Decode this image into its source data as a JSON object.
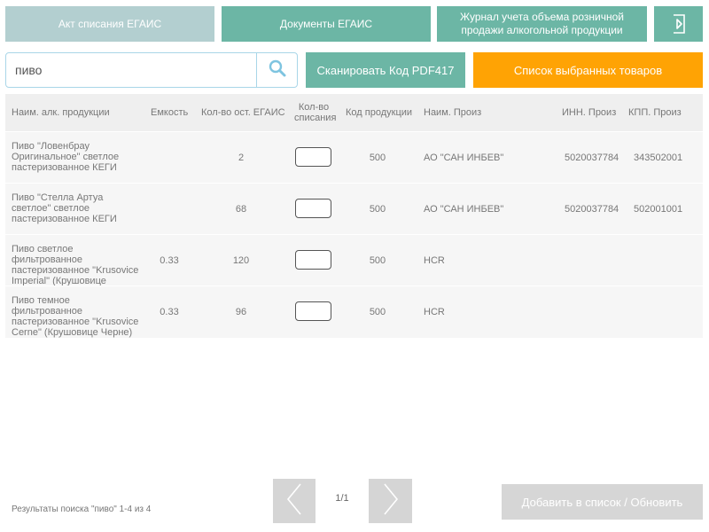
{
  "toolbar": {
    "act_label": "Акт списания ЕГАИС",
    "docs_label": "Документы ЕГАИС",
    "journal_label": "Журнал учета объема розничной продажи алкогольной продукции",
    "exit_icon": "exit-arrow-icon"
  },
  "search": {
    "value": "пиво",
    "icon": "search-icon"
  },
  "actions": {
    "scan_label": "Сканировать Код PDF417",
    "selected_label": "Список выбранных товаров",
    "add_label": "Добавить в список / Обновить"
  },
  "table": {
    "headers": {
      "name": "Наим. алк. продукции",
      "capacity": "Емкость",
      "stock": "Кол-во ост. ЕГАИС",
      "writeoff": "Кол-во списания",
      "code": "Код продукции",
      "producer": "Наим. Произ",
      "inn": "ИНН. Произ",
      "kpp": "КПП. Произ"
    },
    "rows": [
      {
        "name": "Пиво \"Ловенбрау Оригинальное\" светлое пастеризованное КЕГИ",
        "capacity": "",
        "stock": "2",
        "writeoff": "",
        "code": "500",
        "producer": "АО \"САН ИНБЕВ\"",
        "inn": "5020037784",
        "kpp": "343502001"
      },
      {
        "name": "Пиво \"Стелла Артуа светлое\" светлое пастеризованное КЕГИ",
        "capacity": "",
        "stock": "68",
        "writeoff": "",
        "code": "500",
        "producer": "АО \"САН ИНБЕВ\"",
        "inn": "5020037784",
        "kpp": "502001001"
      },
      {
        "name": "Пиво светлое фильтрованное пастеризованное \"Krusovice Imperial\" (Крушовице",
        "capacity": "0.33",
        "stock": "120",
        "writeoff": "",
        "code": "500",
        "producer": "HCR",
        "inn": "",
        "kpp": ""
      },
      {
        "name": "Пиво темное фильтрованное пастеризованное \"Krusovice Cerne\" (Крушовице Черне)",
        "capacity": "0.33",
        "stock": "96",
        "writeoff": "",
        "code": "500",
        "producer": "HCR",
        "inn": "",
        "kpp": ""
      }
    ]
  },
  "footer": {
    "status": "Результаты поиска \"пиво\" 1-4 из 4",
    "page": "1/1"
  },
  "colors": {
    "teal": "#6cb6a5",
    "teal_light": "#b3cfd0",
    "orange": "#ffa304",
    "disabled": "#d6d6d6"
  }
}
